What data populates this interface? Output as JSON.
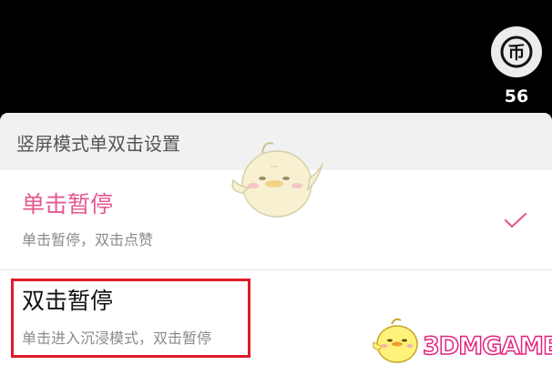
{
  "top_bar": {
    "coin_icon": "coin-icon",
    "coin_glyph": "币",
    "coin_count": "56"
  },
  "sheet": {
    "title": "竖屏模式单双击设置",
    "options": [
      {
        "title": "单击暂停",
        "description": "单击暂停，双击点赞",
        "selected": true,
        "icon": "checkmark-icon"
      },
      {
        "title": "双击暂停",
        "description": "单击进入沉浸模式，双击暂停",
        "selected": false,
        "highlighted": true
      }
    ]
  },
  "watermark": {
    "text": "3DMGAME",
    "icon": "chick-mascot-icon"
  },
  "colors": {
    "accent": "#e4588f",
    "highlight_border": "#e11a2b",
    "watermark_outline": "#e2237d",
    "header_bg": "#f1f1f2"
  }
}
